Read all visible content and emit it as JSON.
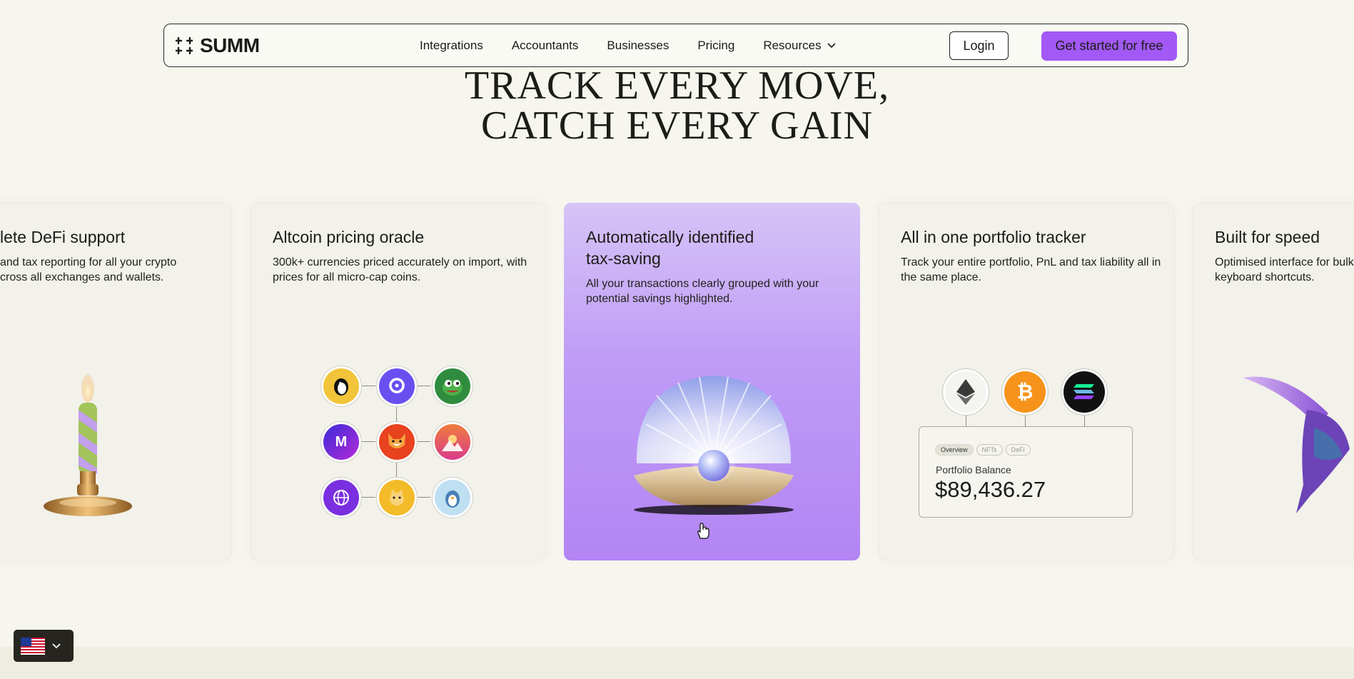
{
  "nav": {
    "logo_text": "SUMM",
    "links": [
      "Integrations",
      "Accountants",
      "Businesses",
      "Pricing",
      "Resources"
    ],
    "login_label": "Login",
    "cta_label": "Get started for free"
  },
  "hero": {
    "line1": "TRACK EVERY MOVE,",
    "line2": "CATCH EVERY GAIN"
  },
  "cards": [
    {
      "title": "lete DeFi support",
      "desc1": "and tax reporting for all your crypto",
      "desc2": "cross all exchanges and wallets."
    },
    {
      "title": "Altcoin pricing oracle",
      "desc1": "300k+ currencies priced accurately on import, with",
      "desc2": "prices for all micro-cap coins."
    },
    {
      "title_line1": "Automatically identified",
      "title_line2": "tax-saving",
      "desc1": "All your transactions clearly grouped with your",
      "desc2": "potential savings highlighted."
    },
    {
      "title": "All in one portfolio tracker",
      "desc1": "Track your entire portfolio, PnL and tax liability all in",
      "desc2": "the same place."
    },
    {
      "title": "Built for speed",
      "desc1": "Optimised interface for bulk",
      "desc2": "keyboard shortcuts."
    }
  ],
  "portfolio": {
    "tabs": [
      "Overview",
      "NFTs",
      "DeFi"
    ],
    "label": "Portfolio Balance",
    "value": "$89,436.27"
  },
  "colors": {
    "accent": "#a259f5",
    "bg": "#f6f5ee"
  }
}
